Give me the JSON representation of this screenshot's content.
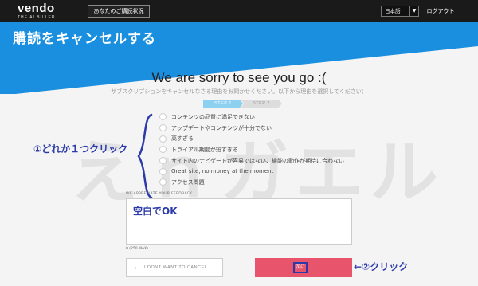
{
  "brand": {
    "name": "vendo",
    "tagline": "THE AI BILLER"
  },
  "topbar": {
    "status_label": "あなたのご購読状況",
    "language": "日本語",
    "logout_label": "ログアウト"
  },
  "page": {
    "title": "購読をキャンセルする",
    "headline": "We are sorry to see you go :(",
    "subtext": "サブスクリプションをキャンセルなさる理由をお聞かせください。以下から理由を選択してください："
  },
  "steps": {
    "step1": "STEP 1",
    "step2": "STEP 2"
  },
  "reasons": [
    "コンテンツの品質に満足できない",
    "アップデートやコンテンツが十分でない",
    "高すぎる",
    "トライアル期間が短すぎる",
    "サイト内のナビゲートが容易ではない、機能の動作が期待に合わない",
    "Great site, no money at the moment",
    "アクセス問題"
  ],
  "watermark": "えｎガエル",
  "annotations": {
    "left": "①どれか１つクリック",
    "feedback_note": "空白でOK",
    "right": "←②クリック"
  },
  "feedback": {
    "label": "WE APPRECIATE YOUR FEEDBACK",
    "char_count": "0 (250 MAX)"
  },
  "buttons": {
    "cancel_arrow": "←",
    "cancel_label": "I DONT WANT TO CANCEL",
    "next_label": "次に"
  },
  "colors": {
    "header_blue": "#1a8fe0",
    "next_button": "#e8546b",
    "annotation": "#2b3aa8",
    "topbar": "#1a1a1a"
  }
}
